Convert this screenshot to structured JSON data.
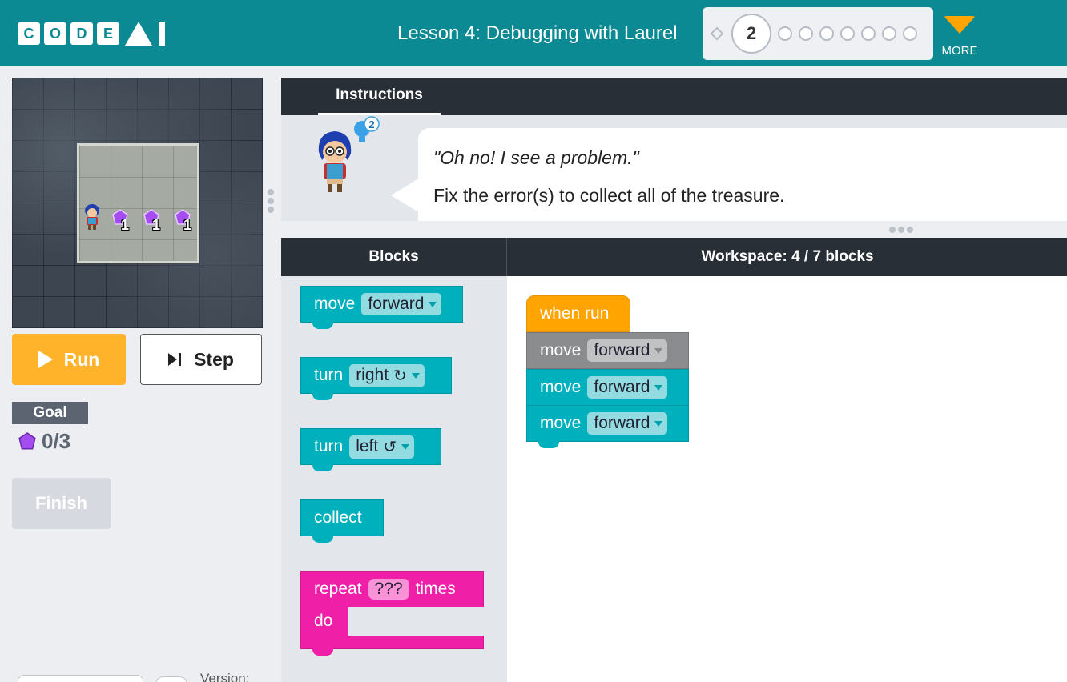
{
  "header": {
    "logo_letters": [
      "C",
      "O",
      "D",
      "E"
    ],
    "lesson_title": "Lesson 4: Debugging with Laurel",
    "current_level": "2",
    "remaining_levels": 7,
    "more_label": "MORE",
    "colors": {
      "bar": "#0c8a94",
      "more_arrow": "#ffa400"
    }
  },
  "left": {
    "maze": {
      "gem_counts": [
        "1",
        "1",
        "1"
      ]
    },
    "run_label": "Run",
    "step_label": "Step",
    "goal_label": "Goal",
    "goal_count": "0/3",
    "finish_label": "Finish",
    "version_label": "Version:"
  },
  "instructions": {
    "tab_label": "Instructions",
    "hint_count": "2",
    "quote": "\"Oh no! I see a problem.\"",
    "text": "Fix the error(s) to collect all of the treasure."
  },
  "blocks_panel": {
    "header": "Blocks",
    "toolbox": [
      {
        "verb": "move",
        "field": "forward"
      },
      {
        "verb": "turn",
        "field": "right",
        "icon": "↻"
      },
      {
        "verb": "turn",
        "field": "left",
        "icon": "↺"
      },
      {
        "verb": "collect"
      },
      {
        "verb": "repeat",
        "field": "???",
        "suffix": "times",
        "body_label": "do"
      }
    ]
  },
  "workspace": {
    "header": "Workspace: 4 / 7 blocks",
    "program": [
      {
        "label": "when run"
      },
      {
        "verb": "move",
        "field": "forward",
        "state": "highlighted"
      },
      {
        "verb": "move",
        "field": "forward"
      },
      {
        "verb": "move",
        "field": "forward"
      }
    ]
  }
}
